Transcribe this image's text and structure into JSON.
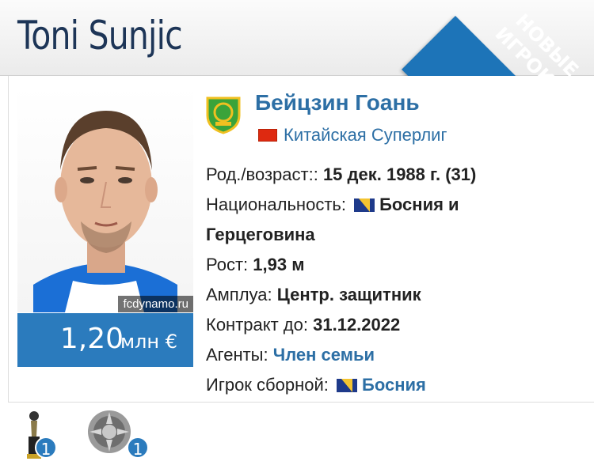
{
  "player": {
    "first_name": "Toni",
    "last_name": "Sunjic"
  },
  "ribbon": {
    "line1": "НОВЫЕ",
    "line2": "ИГРОКИ"
  },
  "photo": {
    "credit": "fcdynamo.ru"
  },
  "market_value": {
    "amount": "1,20",
    "unit": "млн €"
  },
  "club": {
    "name": "Бейцзин Гоань",
    "league": "Китайская Суперлиг"
  },
  "details": {
    "birth_label": "Род./возраст::",
    "birth_value": "15 дек. 1988 г. (31)",
    "nationality_label": "Национальность:",
    "nationality_value_1": "Босния и",
    "nationality_value_2": "Герцеговина",
    "height_label": "Рост:",
    "height_value": "1,93 м",
    "position_label": "Амплуа:",
    "position_value": "Центр. защитник",
    "contract_label": "Контракт до:",
    "contract_value": "31.12.2022",
    "agents_label": "Агенты:",
    "agents_value": "Член семьи",
    "national_label": "Игрок сборной:",
    "national_value": "Босния"
  },
  "achievements": [
    {
      "icon": "trophy-icon",
      "count": "1"
    },
    {
      "icon": "medal-disc-icon",
      "count": "1"
    }
  ],
  "colors": {
    "accent": "#2b7bbd",
    "link": "#2d6fa5",
    "title": "#1d3557"
  }
}
